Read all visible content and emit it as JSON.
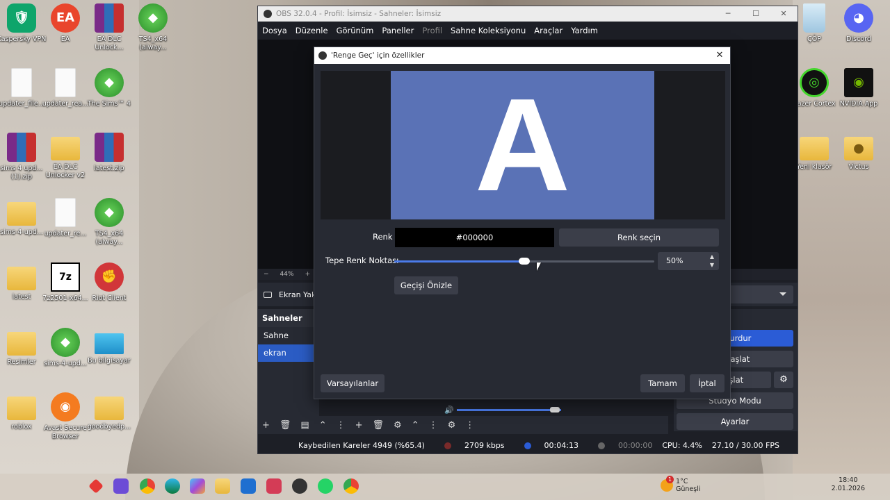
{
  "desktop": {
    "left_icons": [
      {
        "label": "Kaspersky VPN",
        "kind": "kasp",
        "glyph": "🛡"
      },
      {
        "label": "EA",
        "kind": "ea",
        "glyph": "EA"
      },
      {
        "label": "EA DLC Unlock...",
        "kind": "rar",
        "glyph": ""
      },
      {
        "label": "TS4_x64 (alway...",
        "kind": "sims",
        "glyph": "◆"
      },
      {
        "label": "updater_file...",
        "kind": "file",
        "glyph": ""
      },
      {
        "label": "updater_rea...",
        "kind": "file",
        "glyph": ""
      },
      {
        "label": "The Sims™ 4",
        "kind": "sims",
        "glyph": "◆"
      },
      {
        "label": "sims 4 upd... (1).zip",
        "kind": "rar",
        "glyph": ""
      },
      {
        "label": "EA DLC Unlocker v2",
        "kind": "folder",
        "glyph": ""
      },
      {
        "label": "latest.zip",
        "kind": "rar",
        "glyph": ""
      },
      {
        "label": "sims-4-upd...",
        "kind": "folder",
        "glyph": ""
      },
      {
        "label": "updater_re...",
        "kind": "file",
        "glyph": ""
      },
      {
        "label": "TS4_x64 (alway...",
        "kind": "sims",
        "glyph": "◆"
      },
      {
        "label": "latest",
        "kind": "folder",
        "glyph": ""
      },
      {
        "label": "7z2501-x64...",
        "kind": "seven",
        "glyph": "7z"
      },
      {
        "label": "Riot Client",
        "kind": "riot",
        "glyph": "✊"
      },
      {
        "label": "Resimler",
        "kind": "folder",
        "glyph": ""
      },
      {
        "label": "sims-4-upd...",
        "kind": "sims",
        "glyph": "◆"
      },
      {
        "label": "Bu bilgisayar",
        "kind": "pc",
        "glyph": ""
      },
      {
        "label": "roblox",
        "kind": "folder",
        "glyph": ""
      },
      {
        "label": "Avast Secure Browser",
        "kind": "avast",
        "glyph": "◉"
      },
      {
        "label": "goodbyedp...",
        "kind": "folder",
        "glyph": ""
      }
    ],
    "right_icons": [
      {
        "label": "ÇÖP",
        "kind": "bin",
        "glyph": ""
      },
      {
        "label": "Discord",
        "kind": "discord",
        "glyph": "◕"
      },
      {
        "label": "Razer Cortex",
        "kind": "razer",
        "glyph": "◎"
      },
      {
        "label": "NVIDIA App",
        "kind": "nvidia",
        "glyph": "◉"
      },
      {
        "label": "Yeni klasör",
        "kind": "folder",
        "glyph": ""
      },
      {
        "label": "Victus",
        "kind": "victus",
        "glyph": "●"
      }
    ]
  },
  "obs": {
    "title": "OBS 32.0.4 - Profil: İsimsiz - Sahneler: İsimsiz",
    "menu": [
      "Dosya",
      "Düzenle",
      "Görünüm",
      "Paneller",
      "Profil",
      "Sahne Koleksiyonu",
      "Araçlar",
      "Yardım"
    ],
    "zoom_minus": "−",
    "zoom": "44%",
    "zoom_plus": "+",
    "source_label": "Ekran Yak",
    "scenes_header": "Sahneler",
    "scenes": [
      "Sahne",
      "ekran"
    ],
    "controls": {
      "stop_stream": "ı Durdur",
      "start_record": "ı Başlat",
      "start_virtual": "ayı Başlat",
      "studio_mode": "Stüdyo Modu",
      "settings": "Ayarlar"
    },
    "status": {
      "dropped": "Kaybedilen Kareler 4949 (%65.4)",
      "bitrate": "2709 kbps",
      "stream_time": "00:04:13",
      "rec_time": "00:00:00",
      "cpu": "CPU: 4.4%",
      "fps": "27.10 / 30.00 FPS"
    }
  },
  "dialog": {
    "title": "'Renge Geç' için özellikler",
    "preview_letter": "A",
    "color_label": "Renk",
    "color_value": "#000000",
    "choose_color": "Renk seçin",
    "peak_label": "Tepe Renk Noktası",
    "peak_value": "50%",
    "peak_fraction": 0.5,
    "preview_transition": "Geçişi Önizle",
    "defaults": "Varsayılanlar",
    "ok": "Tamam",
    "cancel": "İptal"
  },
  "taskbar": {
    "weather_temp": "1°C",
    "weather_text": "Güneşli",
    "weather_badge": "1",
    "time": "18:40",
    "date": "2.01.2026"
  },
  "colors": {
    "accent": "#2b5cd6",
    "preview_bg": "#5a72b6",
    "obs_bg": "#1d1f26"
  }
}
